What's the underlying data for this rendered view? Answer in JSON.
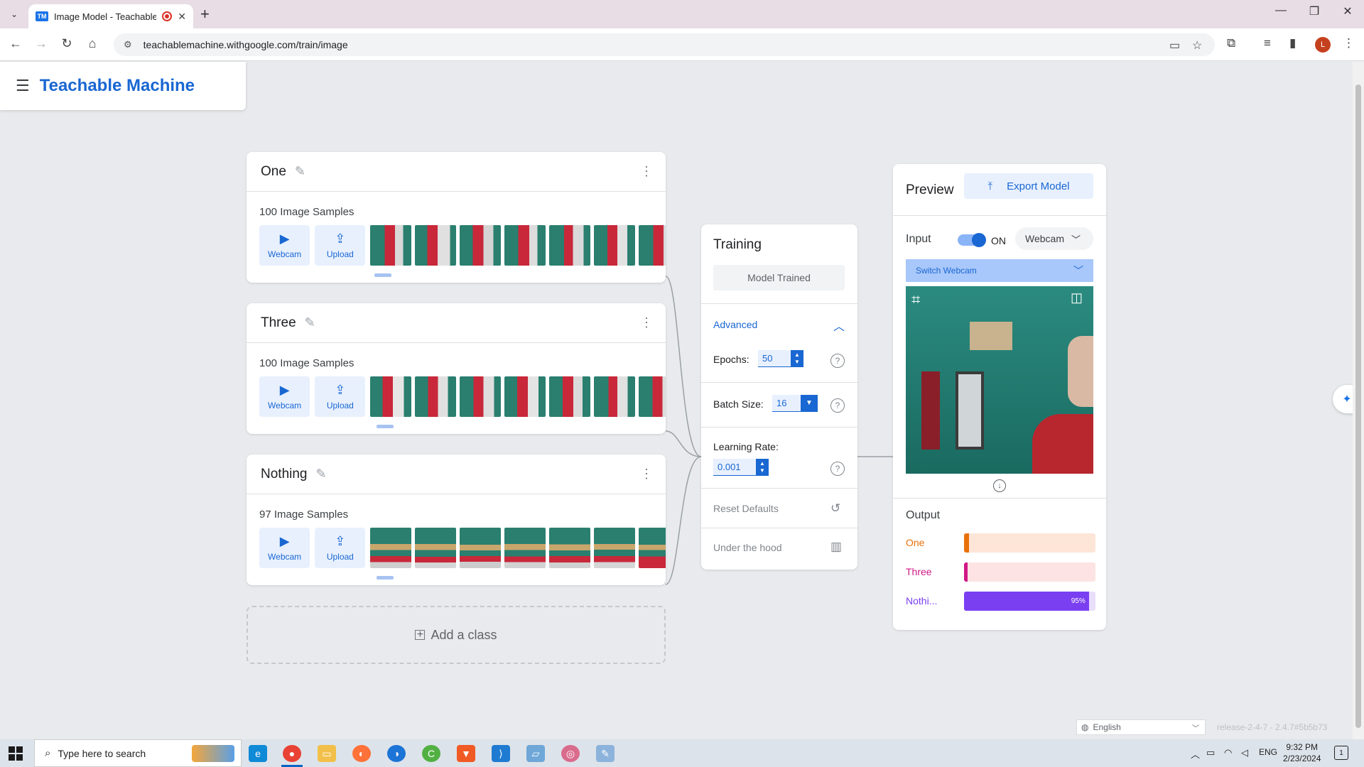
{
  "browser": {
    "tab_title": "Image Model - Teachable M",
    "favicon": "TM",
    "url": "teachablemachine.withgoogle.com/train/image",
    "profile_initial": "L"
  },
  "app": {
    "title": "Teachable Machine"
  },
  "classes": [
    {
      "name": "One",
      "samples": "100 Image Samples",
      "webcam": "Webcam",
      "upload": "Upload"
    },
    {
      "name": "Three",
      "samples": "100 Image Samples",
      "webcam": "Webcam",
      "upload": "Upload"
    },
    {
      "name": "Nothing",
      "samples": "97 Image Samples",
      "webcam": "Webcam",
      "upload": "Upload"
    }
  ],
  "add_class": "Add a class",
  "training": {
    "title": "Training",
    "status_button": "Model Trained",
    "advanced": "Advanced",
    "epochs_label": "Epochs:",
    "epochs_value": "50",
    "batch_label": "Batch Size:",
    "batch_value": "16",
    "lr_label": "Learning Rate:",
    "lr_value": "0.001",
    "reset": "Reset Defaults",
    "under_hood": "Under the hood"
  },
  "preview": {
    "title": "Preview",
    "export": "Export Model",
    "input_label": "Input",
    "toggle_state": "ON",
    "source": "Webcam",
    "switch_webcam": "Switch Webcam",
    "output_label": "Output",
    "outputs": [
      {
        "label": "One",
        "color": "#e8710a",
        "bg": "#fde5d8",
        "fill": "#e8710a",
        "value": 0.03,
        "text": ""
      },
      {
        "label": "Three",
        "color": "#d01884",
        "bg": "#fde3e3",
        "fill": "#d01884",
        "value": 0.0,
        "text": ""
      },
      {
        "label": "Nothi...",
        "color": "#7b3ff2",
        "bg": "#e9defd",
        "fill": "#7b3ff2",
        "value": 0.95,
        "text": "95%"
      }
    ]
  },
  "footer": {
    "language": "English",
    "release": "release-2-4-7 - 2.4.7#5b5b73"
  },
  "taskbar": {
    "search_placeholder": "Type here to search",
    "lang": "ENG",
    "time": "9:32 PM",
    "date": "2/23/2024",
    "notif_count": "1"
  }
}
